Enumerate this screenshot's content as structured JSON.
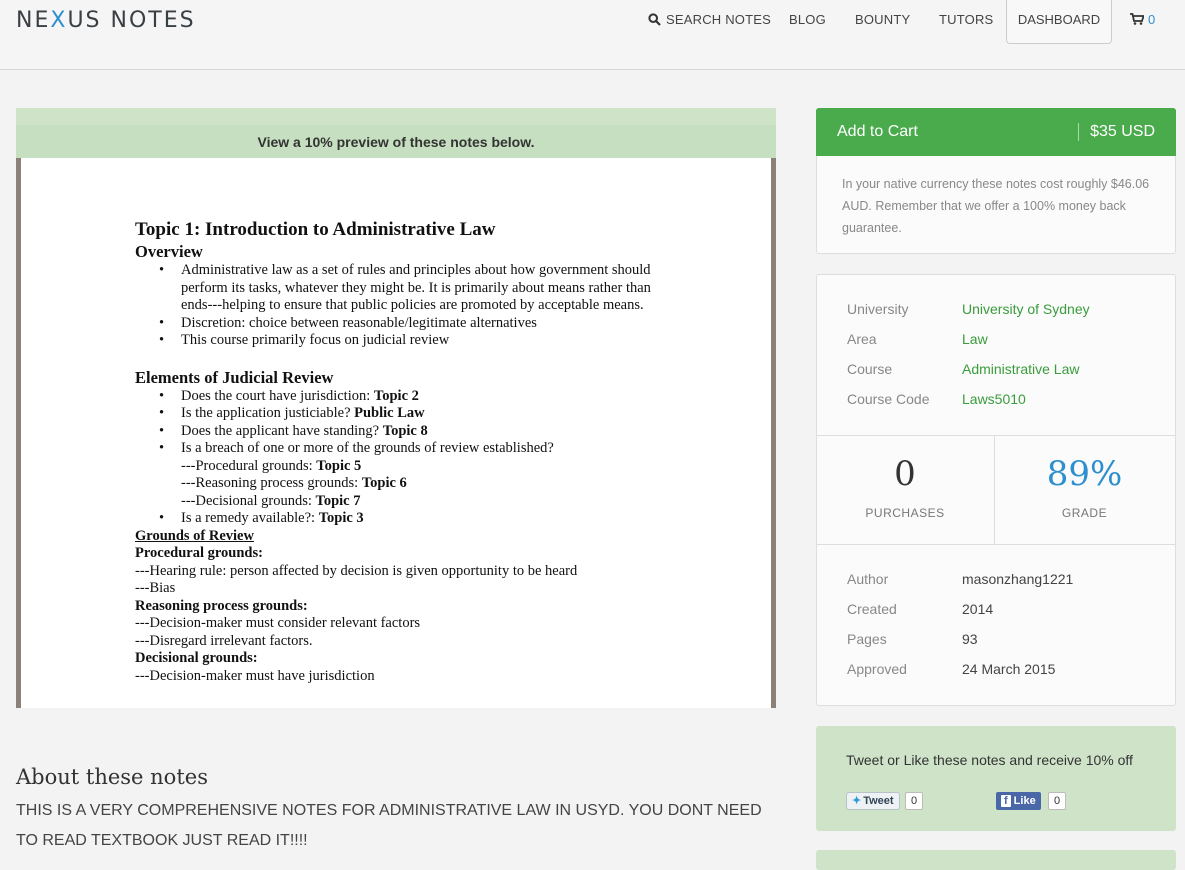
{
  "header": {
    "logo_pre": "NE",
    "logo_x": "X",
    "logo_post": "US NOTES",
    "nav": {
      "search": "SEARCH NOTES",
      "blog": "BLOG",
      "bounty": "BOUNTY",
      "tutors": "TUTORS",
      "dashboard": "DASHBOARD"
    },
    "cart_count": "0"
  },
  "preview": {
    "banner": "View a 10% preview of these notes below.",
    "doc": {
      "title": "Topic 1: Introduction to Administrative Law",
      "overview_heading": "Overview",
      "overview_items": [
        "Administrative law as a set of rules and principles about how government should perform its tasks, whatever they might be. It is primarily about means rather than ends---helping to ensure that public policies are promoted by acceptable means.",
        "Discretion: choice between reasonable/legitimate alternatives",
        "This course primarily focus on judicial review"
      ],
      "elements_heading": "Elements of Judicial Review",
      "elements_items": [
        {
          "text": "Does the court have jurisdiction: ",
          "bold": "Topic 2"
        },
        {
          "text": "Is the application justiciable? ",
          "bold": "Public Law"
        },
        {
          "text": "Does the applicant have standing? ",
          "bold": "Topic 8"
        },
        {
          "text": "Is a breach of one or more of the grounds of review established?",
          "bold": ""
        }
      ],
      "sub_items": [
        {
          "text": "---Procedural grounds: ",
          "bold": "Topic 5"
        },
        {
          "text": "---Reasoning process grounds: ",
          "bold": "Topic 6"
        },
        {
          "text": "---Decisional grounds: ",
          "bold": "Topic 7"
        }
      ],
      "remedy": {
        "text": "Is a remedy available?: ",
        "bold": "Topic 3"
      },
      "grounds_heading": "Grounds of Review",
      "procedural_heading": "Procedural grounds:",
      "procedural_lines": [
        "---Hearing rule: person affected by decision is given opportunity to be heard",
        "---Bias"
      ],
      "reasoning_heading": "Reasoning process grounds:",
      "reasoning_lines": [
        "---Decision-maker must consider relevant factors",
        "---Disregard irrelevant factors."
      ],
      "decisional_heading": "Decisional grounds:",
      "decisional_lines": [
        "---Decision-maker must have jurisdiction"
      ]
    }
  },
  "about": {
    "title": "About these notes",
    "text": "THIS IS A VERY COMPREHENSIVE NOTES FOR ADMINISTRATIVE LAW IN USYD. YOU DONT NEED TO READ TEXTBOOK JUST READ IT!!!!"
  },
  "purchase": {
    "add_to_cart": "Add to Cart",
    "price": "$35 USD",
    "currency_note": "In your native currency these notes cost roughly $46.06 AUD. Remember that we offer a 100% money back guarantee."
  },
  "info": {
    "rows": [
      {
        "key": "University",
        "value": "University of Sydney"
      },
      {
        "key": "Area",
        "value": "Law"
      },
      {
        "key": "Course",
        "value": "Administrative Law"
      },
      {
        "key": "Course Code",
        "value": "Laws5010"
      }
    ],
    "purchases_value": "0",
    "purchases_label": "PURCHASES",
    "grade_value": "89%",
    "grade_label": "GRADE",
    "meta": [
      {
        "key": "Author",
        "value": "masonzhang1221"
      },
      {
        "key": "Created",
        "value": "2014"
      },
      {
        "key": "Pages",
        "value": "93"
      },
      {
        "key": "Approved",
        "value": "24 March 2015"
      }
    ]
  },
  "share": {
    "text": "Tweet or Like these notes and receive 10% off",
    "tweet_label": "Tweet",
    "tweet_count": "0",
    "like_icon": "f",
    "like_label": "Like",
    "like_count": "0"
  },
  "colors": {
    "accent_green": "#4aab4d",
    "link_green": "#3a9c3d",
    "accent_blue": "#2e8fcf",
    "panel_green": "#cfe3c9"
  }
}
